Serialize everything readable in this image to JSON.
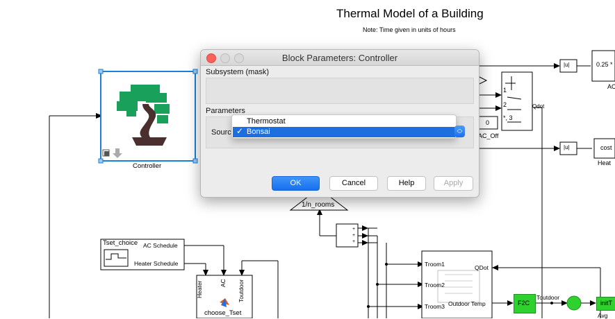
{
  "model": {
    "title": "Thermal Model of a Building",
    "note": "Note: Time given in units of hours"
  },
  "blocks": {
    "controller_label": "Controller",
    "n_rooms": "1/n_rooms",
    "gain_label": "0.25 *",
    "ac_label": "AC",
    "cost_label": "cost",
    "heat_label": "Heat",
    "abs_label": "|u|",
    "switch_port1": "1",
    "switch_port2": "2",
    "switch_port3": "*, 3",
    "qdot_label": "Qdot",
    "const_value": "0",
    "ac_off_label": "AC_Off",
    "tset_choice": "Tset_choice",
    "ac_schedule": "AC Schedule",
    "heater_schedule": "Heater Schedule",
    "fn_port_heater": "Heater",
    "fn_port_ac": "AC",
    "fn_port_toutdoor": "Toutdoor",
    "fn_name": "choose_Tset",
    "troom1": "Troom1",
    "troom2": "Troom2",
    "troom3": "Troom3",
    "house_qdot": "QDot",
    "outdoor_temp": "Outdoor Temp",
    "f2c": "F2C",
    "toutdoor": "Toutdoor",
    "init_label": "initT",
    "avg_label": "Avg",
    "sum_signs": "+ + +"
  },
  "dialog": {
    "title": "Block Parameters: Controller",
    "section_mask": "Subsystem (mask)",
    "section_params": "Parameters",
    "source_label": "Source",
    "options": [
      "Thermostat",
      "Bonsai"
    ],
    "selected_option": "Bonsai",
    "buttons": {
      "ok": "OK",
      "cancel": "Cancel",
      "help": "Help",
      "apply": "Apply"
    }
  },
  "colors": {
    "ok_blue": "#1670ee",
    "selection_blue": "#1d6fe0",
    "block_green": "#2ed12e",
    "controller_border": "#1a7fd6",
    "close_red": "#fc605c"
  }
}
